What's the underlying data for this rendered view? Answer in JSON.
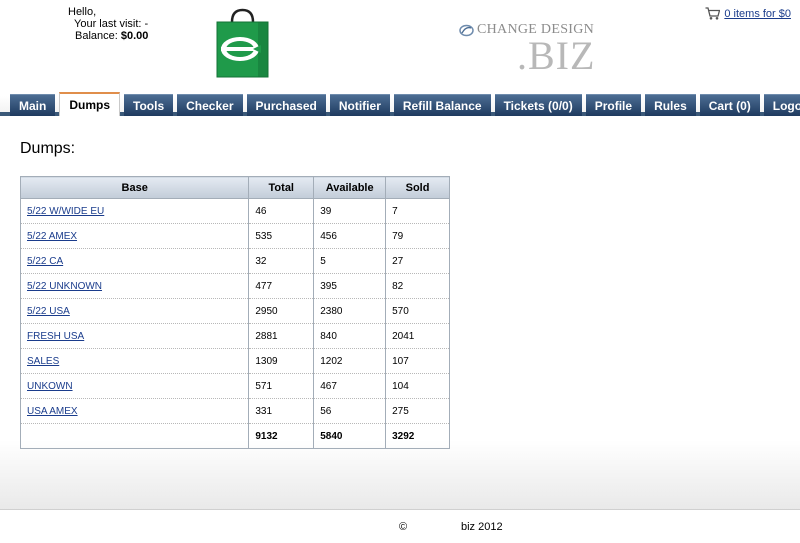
{
  "header": {
    "hello": "Hello,",
    "last_visit": "Your last visit: -",
    "balance_label": "Balance:",
    "balance_value": "$0.00",
    "brand_top": "CHANGE DESIGN",
    "brand_biz": ".BIZ",
    "cart_text": "0 items for $0",
    "cart_icon": "shopping-cart-icon",
    "logo_icon": "shopping-bag-logo-icon"
  },
  "colors": {
    "nav_tab": "#2b4a70",
    "active_tab_accent": "#e08e4b",
    "logo_green": "#1f9a4a",
    "link": "#1a3c8c"
  },
  "nav": {
    "tabs": [
      {
        "label": "Main"
      },
      {
        "label": "Dumps",
        "active": true
      },
      {
        "label": "Tools"
      },
      {
        "label": "Checker"
      },
      {
        "label": "Purchased"
      },
      {
        "label": "Notifier"
      },
      {
        "label": "Refill Balance"
      },
      {
        "label": "Tickets (0/0)"
      },
      {
        "label": "Profile"
      },
      {
        "label": "Rules"
      },
      {
        "label": "Cart (0)"
      },
      {
        "label": "Logout"
      }
    ]
  },
  "main": {
    "title": "Dumps:",
    "table": {
      "headers": [
        "Base",
        "Total",
        "Available",
        "Sold"
      ],
      "rows": [
        [
          "5/22 W/WIDE EU",
          "46",
          "39",
          "7"
        ],
        [
          "5/22 AMEX",
          "535",
          "456",
          "79"
        ],
        [
          "5/22 CA",
          "32",
          "5",
          "27"
        ],
        [
          "5/22 UNKNOWN",
          "477",
          "395",
          "82"
        ],
        [
          "5/22 USA",
          "2950",
          "2380",
          "570"
        ],
        [
          "FRESH USA",
          "2881",
          "840",
          "2041"
        ],
        [
          "SALES",
          "1309",
          "1202",
          "107"
        ],
        [
          "UNKOWN",
          "571",
          "467",
          "104"
        ],
        [
          "USA AMEX",
          "331",
          "56",
          "275"
        ]
      ],
      "totals": [
        "",
        "9132",
        "5840",
        "3292"
      ]
    }
  },
  "footer": {
    "copyright": "©",
    "text": "biz 2012"
  }
}
